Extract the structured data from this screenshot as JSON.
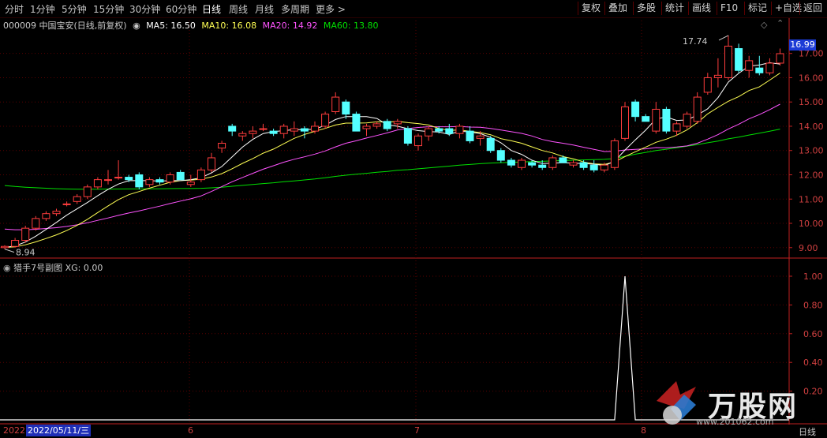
{
  "toolbar": {
    "tabs": [
      "分时",
      "1分钟",
      "5分钟",
      "15分钟",
      "30分钟",
      "60分钟",
      "日线",
      "周线",
      "月线",
      "多周期",
      "更多 >"
    ],
    "active_tab": "日线",
    "right_buttons": [
      "复权",
      "叠加",
      "多股",
      "统计",
      "画线",
      "F10",
      "标记",
      "+自选",
      "返回"
    ]
  },
  "stock": {
    "code_name": "000009 中国宝安(日线,前复权)",
    "ma5": "MA5: 16.50",
    "ma10": "MA10: 16.08",
    "ma20": "MA20: 14.92",
    "ma60": "MA60: 13.80"
  },
  "colors": {
    "up": "#ff3d3d",
    "down": "#54ffff",
    "ma5": "#ffffff",
    "ma10": "#ffff54",
    "ma20": "#ff54ff",
    "ma60": "#00e000",
    "grid": "#5a0000",
    "axis": "#c02020"
  },
  "price_axis": {
    "ticks": [
      "17.00",
      "16.00",
      "15.00",
      "14.00",
      "13.00",
      "12.00",
      "11.00",
      "10.00",
      "9.00"
    ],
    "current": "16.99"
  },
  "annotations": {
    "high": "17.74",
    "low": "8.94"
  },
  "indicator": {
    "title": "猎手7号副图 XG: 0.00",
    "ticks": [
      "1.00",
      "0.80",
      "0.60",
      "0.40",
      "0.20"
    ]
  },
  "date_axis": {
    "year": "2022",
    "cursor_date": "2022/05/11/三",
    "months": [
      "6",
      "7",
      "8"
    ],
    "period": "日线"
  },
  "watermark": {
    "text": "万股网",
    "url": "www.201062.com"
  },
  "chart_data": {
    "type": "candlestick",
    "candles": [
      [
        9.0,
        9.1,
        8.94,
        9.05
      ],
      [
        9.05,
        9.4,
        9.0,
        9.3
      ],
      [
        9.3,
        9.9,
        9.2,
        9.8
      ],
      [
        9.8,
        10.3,
        9.7,
        10.2
      ],
      [
        10.2,
        10.5,
        10.1,
        10.4
      ],
      [
        10.4,
        10.6,
        10.3,
        10.5
      ],
      [
        10.8,
        10.9,
        10.7,
        10.8
      ],
      [
        10.9,
        11.2,
        10.8,
        11.1
      ],
      [
        11.1,
        11.6,
        11.0,
        11.5
      ],
      [
        11.5,
        11.9,
        11.4,
        11.8
      ],
      [
        11.8,
        12.2,
        11.6,
        11.8
      ],
      [
        11.9,
        12.6,
        11.8,
        11.9
      ],
      [
        11.9,
        12.0,
        11.7,
        11.8
      ],
      [
        12.0,
        12.1,
        11.4,
        11.5
      ],
      [
        11.6,
        11.9,
        11.5,
        11.8
      ],
      [
        11.8,
        11.9,
        11.6,
        11.7
      ],
      [
        11.7,
        12.1,
        11.6,
        12.0
      ],
      [
        12.1,
        12.2,
        11.8,
        11.8
      ],
      [
        11.6,
        12.0,
        11.5,
        11.7
      ],
      [
        11.8,
        12.3,
        11.7,
        12.2
      ],
      [
        12.2,
        12.9,
        12.1,
        12.7
      ],
      [
        13.1,
        13.4,
        12.9,
        13.3
      ],
      [
        14.0,
        14.1,
        13.6,
        13.8
      ],
      [
        13.6,
        13.8,
        13.4,
        13.7
      ],
      [
        13.7,
        14.0,
        13.5,
        13.8
      ],
      [
        13.9,
        14.1,
        13.8,
        13.9
      ],
      [
        13.8,
        13.9,
        13.6,
        13.7
      ],
      [
        13.7,
        14.1,
        13.5,
        14.0
      ],
      [
        13.8,
        14.2,
        13.6,
        13.9
      ],
      [
        13.9,
        14.0,
        13.5,
        13.8
      ],
      [
        13.8,
        14.2,
        13.7,
        14.0
      ],
      [
        14.0,
        14.6,
        13.9,
        14.5
      ],
      [
        14.6,
        15.4,
        14.5,
        15.2
      ],
      [
        15.0,
        15.1,
        14.3,
        14.5
      ],
      [
        14.5,
        14.6,
        13.8,
        13.8
      ],
      [
        13.9,
        14.1,
        13.6,
        14.0
      ],
      [
        14.0,
        14.2,
        13.9,
        14.1
      ],
      [
        14.2,
        14.3,
        13.8,
        13.9
      ],
      [
        14.1,
        14.3,
        13.9,
        14.2
      ],
      [
        13.9,
        14.0,
        13.2,
        13.3
      ],
      [
        13.2,
        13.7,
        13.0,
        13.6
      ],
      [
        13.6,
        14.0,
        13.4,
        13.9
      ],
      [
        13.9,
        14.0,
        13.7,
        13.8
      ],
      [
        13.9,
        14.1,
        13.6,
        13.7
      ],
      [
        13.7,
        14.1,
        13.5,
        14.0
      ],
      [
        13.8,
        14.0,
        13.3,
        13.4
      ],
      [
        13.5,
        13.8,
        13.2,
        13.6
      ],
      [
        13.5,
        13.6,
        12.9,
        13.0
      ],
      [
        13.0,
        13.1,
        12.5,
        12.6
      ],
      [
        12.6,
        12.7,
        12.3,
        12.4
      ],
      [
        12.3,
        12.7,
        12.2,
        12.6
      ],
      [
        12.5,
        12.6,
        12.3,
        12.4
      ],
      [
        12.4,
        12.6,
        12.2,
        12.3
      ],
      [
        12.3,
        12.8,
        12.2,
        12.7
      ],
      [
        12.7,
        12.8,
        12.5,
        12.5
      ],
      [
        12.4,
        12.6,
        12.3,
        12.5
      ],
      [
        12.5,
        12.6,
        12.2,
        12.3
      ],
      [
        12.4,
        12.6,
        12.1,
        12.2
      ],
      [
        12.2,
        12.5,
        12.1,
        12.4
      ],
      [
        12.3,
        13.5,
        12.2,
        13.4
      ],
      [
        13.5,
        15.0,
        13.4,
        14.8
      ],
      [
        15.0,
        15.1,
        14.2,
        14.4
      ],
      [
        14.4,
        14.5,
        14.2,
        14.2
      ],
      [
        13.8,
        15.0,
        13.7,
        14.7
      ],
      [
        14.7,
        14.8,
        13.7,
        13.8
      ],
      [
        13.8,
        14.2,
        13.6,
        14.1
      ],
      [
        14.0,
        14.6,
        13.9,
        14.5
      ],
      [
        14.2,
        15.4,
        14.1,
        15.2
      ],
      [
        15.4,
        16.2,
        15.3,
        16.0
      ],
      [
        16.0,
        16.8,
        15.6,
        16.1
      ],
      [
        16.0,
        17.74,
        15.9,
        17.3
      ],
      [
        17.2,
        17.4,
        16.2,
        16.3
      ],
      [
        16.3,
        16.9,
        16.0,
        16.7
      ],
      [
        16.4,
        16.9,
        16.1,
        16.2
      ],
      [
        16.2,
        16.8,
        16.1,
        16.6
      ],
      [
        16.6,
        17.2,
        16.5,
        16.99
      ]
    ],
    "xg_signal_index": 60
  }
}
